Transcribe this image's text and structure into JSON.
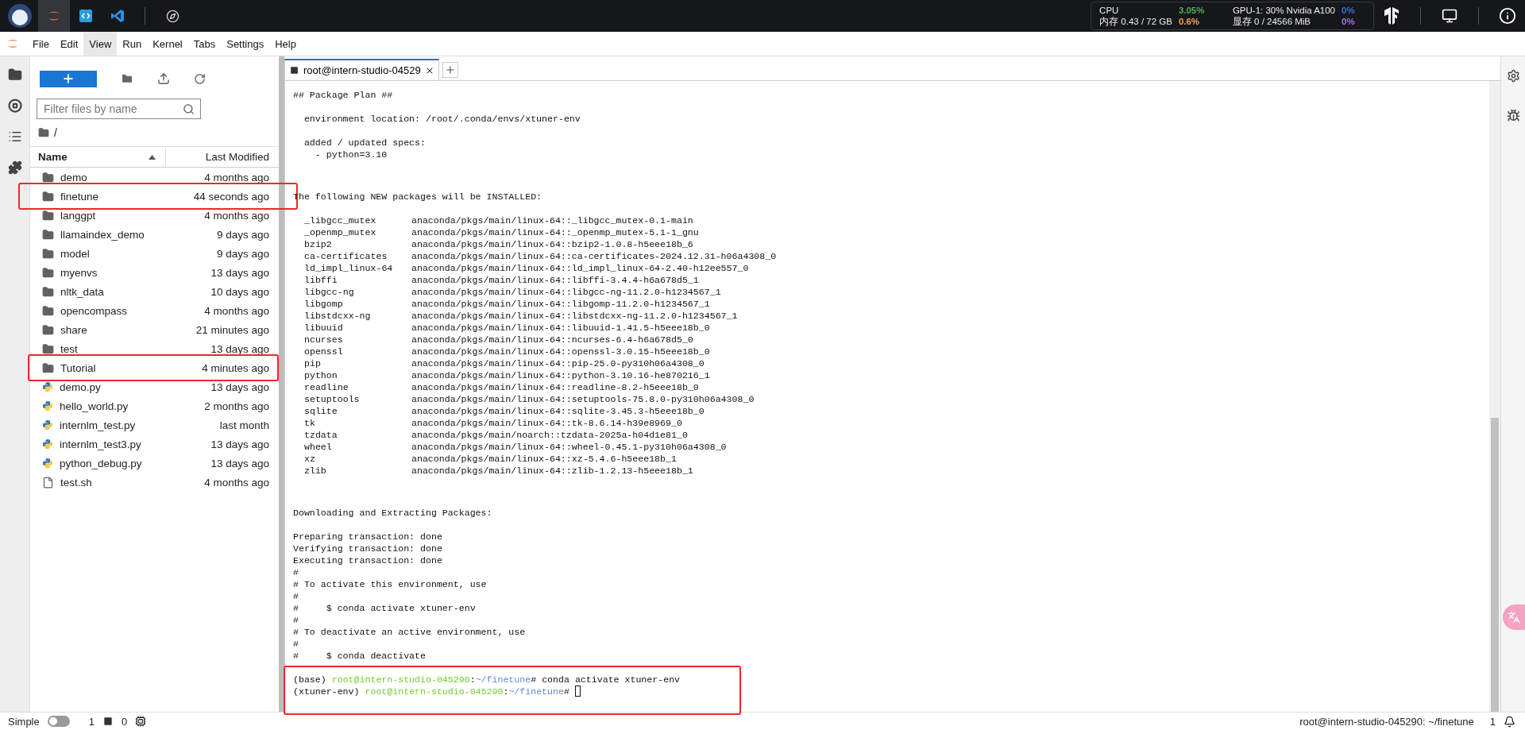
{
  "topbar": {
    "apps": [
      {
        "kind": "jupyter",
        "selected": true
      },
      {
        "kind": "code",
        "selected": false
      },
      {
        "kind": "vscode",
        "selected": false
      },
      {
        "kind": "compass",
        "selected": false
      }
    ],
    "resources": [
      {
        "label": "CPU",
        "value": "3.05%",
        "color": "#4caf50"
      },
      {
        "label": "GPU-1: 30% Nvidia A100",
        "value": "0%",
        "color": "#3b6ef5"
      },
      {
        "label": "内存 0.43 / 72 GB",
        "value": "0.6%",
        "color": "#f0a050"
      },
      {
        "label": "显存 0 / 24566 MiB",
        "value": "0%",
        "color": "#a66cf5"
      }
    ]
  },
  "menu": [
    {
      "label": "File",
      "selected": false
    },
    {
      "label": "Edit",
      "selected": false
    },
    {
      "label": "View",
      "selected": true
    },
    {
      "label": "Run",
      "selected": false
    },
    {
      "label": "Kernel",
      "selected": false
    },
    {
      "label": "Tabs",
      "selected": false
    },
    {
      "label": "Settings",
      "selected": false
    },
    {
      "label": "Help",
      "selected": false
    }
  ],
  "file_browser": {
    "filter": {
      "placeholder": "Filter files by name"
    },
    "path": "/",
    "columns": {
      "name": "Name",
      "modified": "Last Modified"
    },
    "rows": [
      {
        "name": "demo",
        "modified": "4 months ago",
        "kind": "folder",
        "highlighted": false
      },
      {
        "name": "finetune",
        "modified": "44 seconds ago",
        "kind": "folder",
        "highlighted": true
      },
      {
        "name": "langgpt",
        "modified": "4 months ago",
        "kind": "folder",
        "highlighted": false
      },
      {
        "name": "llamaindex_demo",
        "modified": "9 days ago",
        "kind": "folder",
        "highlighted": false
      },
      {
        "name": "model",
        "modified": "9 days ago",
        "kind": "folder",
        "highlighted": false
      },
      {
        "name": "myenvs",
        "modified": "13 days ago",
        "kind": "folder",
        "highlighted": false
      },
      {
        "name": "nltk_data",
        "modified": "10 days ago",
        "kind": "folder",
        "highlighted": false
      },
      {
        "name": "opencompass",
        "modified": "4 months ago",
        "kind": "folder",
        "highlighted": false
      },
      {
        "name": "share",
        "modified": "21 minutes ago",
        "kind": "folder",
        "highlighted": false
      },
      {
        "name": "test",
        "modified": "13 days ago",
        "kind": "folder",
        "highlighted": false
      },
      {
        "name": "Tutorial",
        "modified": "4 minutes ago",
        "kind": "folder",
        "highlighted": true
      },
      {
        "name": "demo.py",
        "modified": "13 days ago",
        "kind": "python",
        "highlighted": false
      },
      {
        "name": "hello_world.py",
        "modified": "2 months ago",
        "kind": "python",
        "highlighted": false
      },
      {
        "name": "internlm_test.py",
        "modified": "last month",
        "kind": "python",
        "highlighted": false
      },
      {
        "name": "internlm_test3.py",
        "modified": "13 days ago",
        "kind": "python",
        "highlighted": false
      },
      {
        "name": "python_debug.py",
        "modified": "13 days ago",
        "kind": "python",
        "highlighted": false
      },
      {
        "name": "test.sh",
        "modified": "4 months ago",
        "kind": "file",
        "highlighted": false
      }
    ]
  },
  "tabs": [
    {
      "label": "root@intern-studio-04529",
      "selected": true
    }
  ],
  "terminal": {
    "blocks": [
      {
        "kind": "text",
        "lines": [
          "## Package Plan ##"
        ]
      },
      {
        "kind": "text",
        "lines": [
          "  environment location: /root/.conda/envs/xtuner-env"
        ]
      },
      {
        "kind": "text",
        "lines": [
          "  added / updated specs:",
          "    - python=3.10"
        ]
      },
      {
        "kind": "section",
        "lines": [
          "The following NEW packages will be INSTALLED:"
        ]
      },
      {
        "kind": "packages",
        "packages": [
          [
            "_libgcc_mutex",
            "anaconda/pkgs/main/linux-64::_libgcc_mutex-0.1-main"
          ],
          [
            "_openmp_mutex",
            "anaconda/pkgs/main/linux-64::_openmp_mutex-5.1-1_gnu"
          ],
          [
            "bzip2",
            "anaconda/pkgs/main/linux-64::bzip2-1.0.8-h5eee18b_6"
          ],
          [
            "ca-certificates",
            "anaconda/pkgs/main/linux-64::ca-certificates-2024.12.31-h06a4308_0"
          ],
          [
            "ld_impl_linux-64",
            "anaconda/pkgs/main/linux-64::ld_impl_linux-64-2.40-h12ee557_0"
          ],
          [
            "libffi",
            "anaconda/pkgs/main/linux-64::libffi-3.4.4-h6a678d5_1"
          ],
          [
            "libgcc-ng",
            "anaconda/pkgs/main/linux-64::libgcc-ng-11.2.0-h1234567_1"
          ],
          [
            "libgomp",
            "anaconda/pkgs/main/linux-64::libgomp-11.2.0-h1234567_1"
          ],
          [
            "libstdcxx-ng",
            "anaconda/pkgs/main/linux-64::libstdcxx-ng-11.2.0-h1234567_1"
          ],
          [
            "libuuid",
            "anaconda/pkgs/main/linux-64::libuuid-1.41.5-h5eee18b_0"
          ],
          [
            "ncurses",
            "anaconda/pkgs/main/linux-64::ncurses-6.4-h6a678d5_0"
          ],
          [
            "openssl",
            "anaconda/pkgs/main/linux-64::openssl-3.0.15-h5eee18b_0"
          ],
          [
            "pip",
            "anaconda/pkgs/main/linux-64::pip-25.0-py310h06a4308_0"
          ],
          [
            "python",
            "anaconda/pkgs/main/linux-64::python-3.10.16-he870216_1"
          ],
          [
            "readline",
            "anaconda/pkgs/main/linux-64::readline-8.2-h5eee18b_0"
          ],
          [
            "setuptools",
            "anaconda/pkgs/main/linux-64::setuptools-75.8.0-py310h06a4308_0"
          ],
          [
            "sqlite",
            "anaconda/pkgs/main/linux-64::sqlite-3.45.3-h5eee18b_0"
          ],
          [
            "tk",
            "anaconda/pkgs/main/linux-64::tk-8.6.14-h39e8969_0"
          ],
          [
            "tzdata",
            "anaconda/pkgs/main/noarch::tzdata-2025a-h04d1e81_0"
          ],
          [
            "wheel",
            "anaconda/pkgs/main/linux-64::wheel-0.45.1-py310h06a4308_0"
          ],
          [
            "xz",
            "anaconda/pkgs/main/linux-64::xz-5.4.6-h5eee18b_1"
          ],
          [
            "zlib",
            "anaconda/pkgs/main/linux-64::zlib-1.2.13-h5eee18b_1"
          ]
        ]
      },
      {
        "kind": "section",
        "lines": [
          "Downloading and Extracting Packages:"
        ]
      },
      {
        "kind": "text",
        "lines": [
          "Preparing transaction: done",
          "Verifying transaction: done",
          "Executing transaction: done",
          "#",
          "# To activate this environment, use",
          "#",
          "#     $ conda activate xtuner-env",
          "#",
          "# To deactivate an active environment, use",
          "#",
          "#     $ conda deactivate"
        ]
      },
      {
        "kind": "prompt",
        "highlighted": true,
        "prompts": [
          {
            "env": "(base)",
            "user": "root@intern-studio-045290",
            "colon": ":",
            "path": "~/finetune",
            "mark": "#",
            "command": "conda activate xtuner-env",
            "cursor": false
          },
          {
            "env": "(xtuner-env)",
            "user": "root@intern-studio-045290",
            "colon": ":",
            "path": "~/finetune",
            "mark": "#",
            "cursor": true
          }
        ]
      }
    ]
  },
  "status_bar": {
    "mode": {
      "label": "Simple",
      "on": false
    },
    "terminals": "1",
    "kernels": "0",
    "location": "root@intern-studio-045290: ~/finetune",
    "notifications": "1"
  }
}
